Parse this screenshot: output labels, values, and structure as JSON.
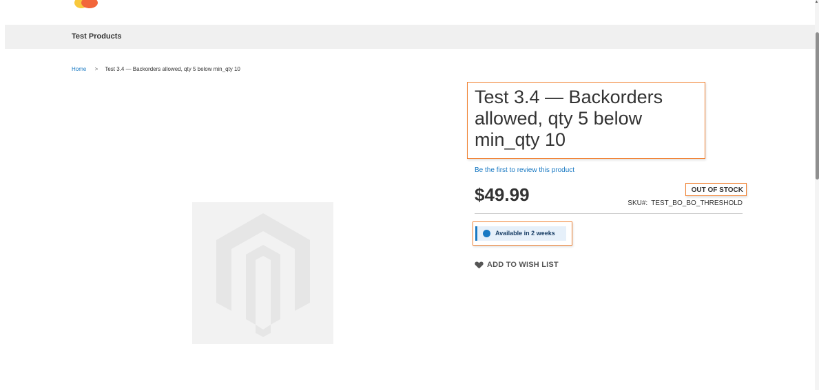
{
  "nav": {
    "category": "Test Products"
  },
  "breadcrumb": {
    "home": "Home",
    "separator": ">",
    "current": "Test 3.4 — Backorders allowed, qty 5 below min_qty 10"
  },
  "product": {
    "title": "Test 3.4 — Backorders allowed, qty 5 below min_qty 10",
    "review_link": "Be the first to review this product",
    "price": "$49.99",
    "stock_status": "OUT OF STOCK",
    "sku_label": "SKU#:",
    "sku_value": "TEST_BO_BO_THRESHOLD",
    "availability": "Available in 2 weeks",
    "wishlist": "ADD TO WISH LIST"
  },
  "icons": {
    "logo": "magento-logo-fragment",
    "product_placeholder": "magento-placeholder-icon",
    "availability": "status-dot-icon",
    "wishlist": "heart-icon",
    "scroll_up": "chevron-up-icon"
  },
  "colors": {
    "link": "#1979c3",
    "highlight_border": "#f07f2e",
    "nav_bg": "#f0f0f0",
    "availability_bg": "#e6f0fa",
    "text": "#333333"
  }
}
